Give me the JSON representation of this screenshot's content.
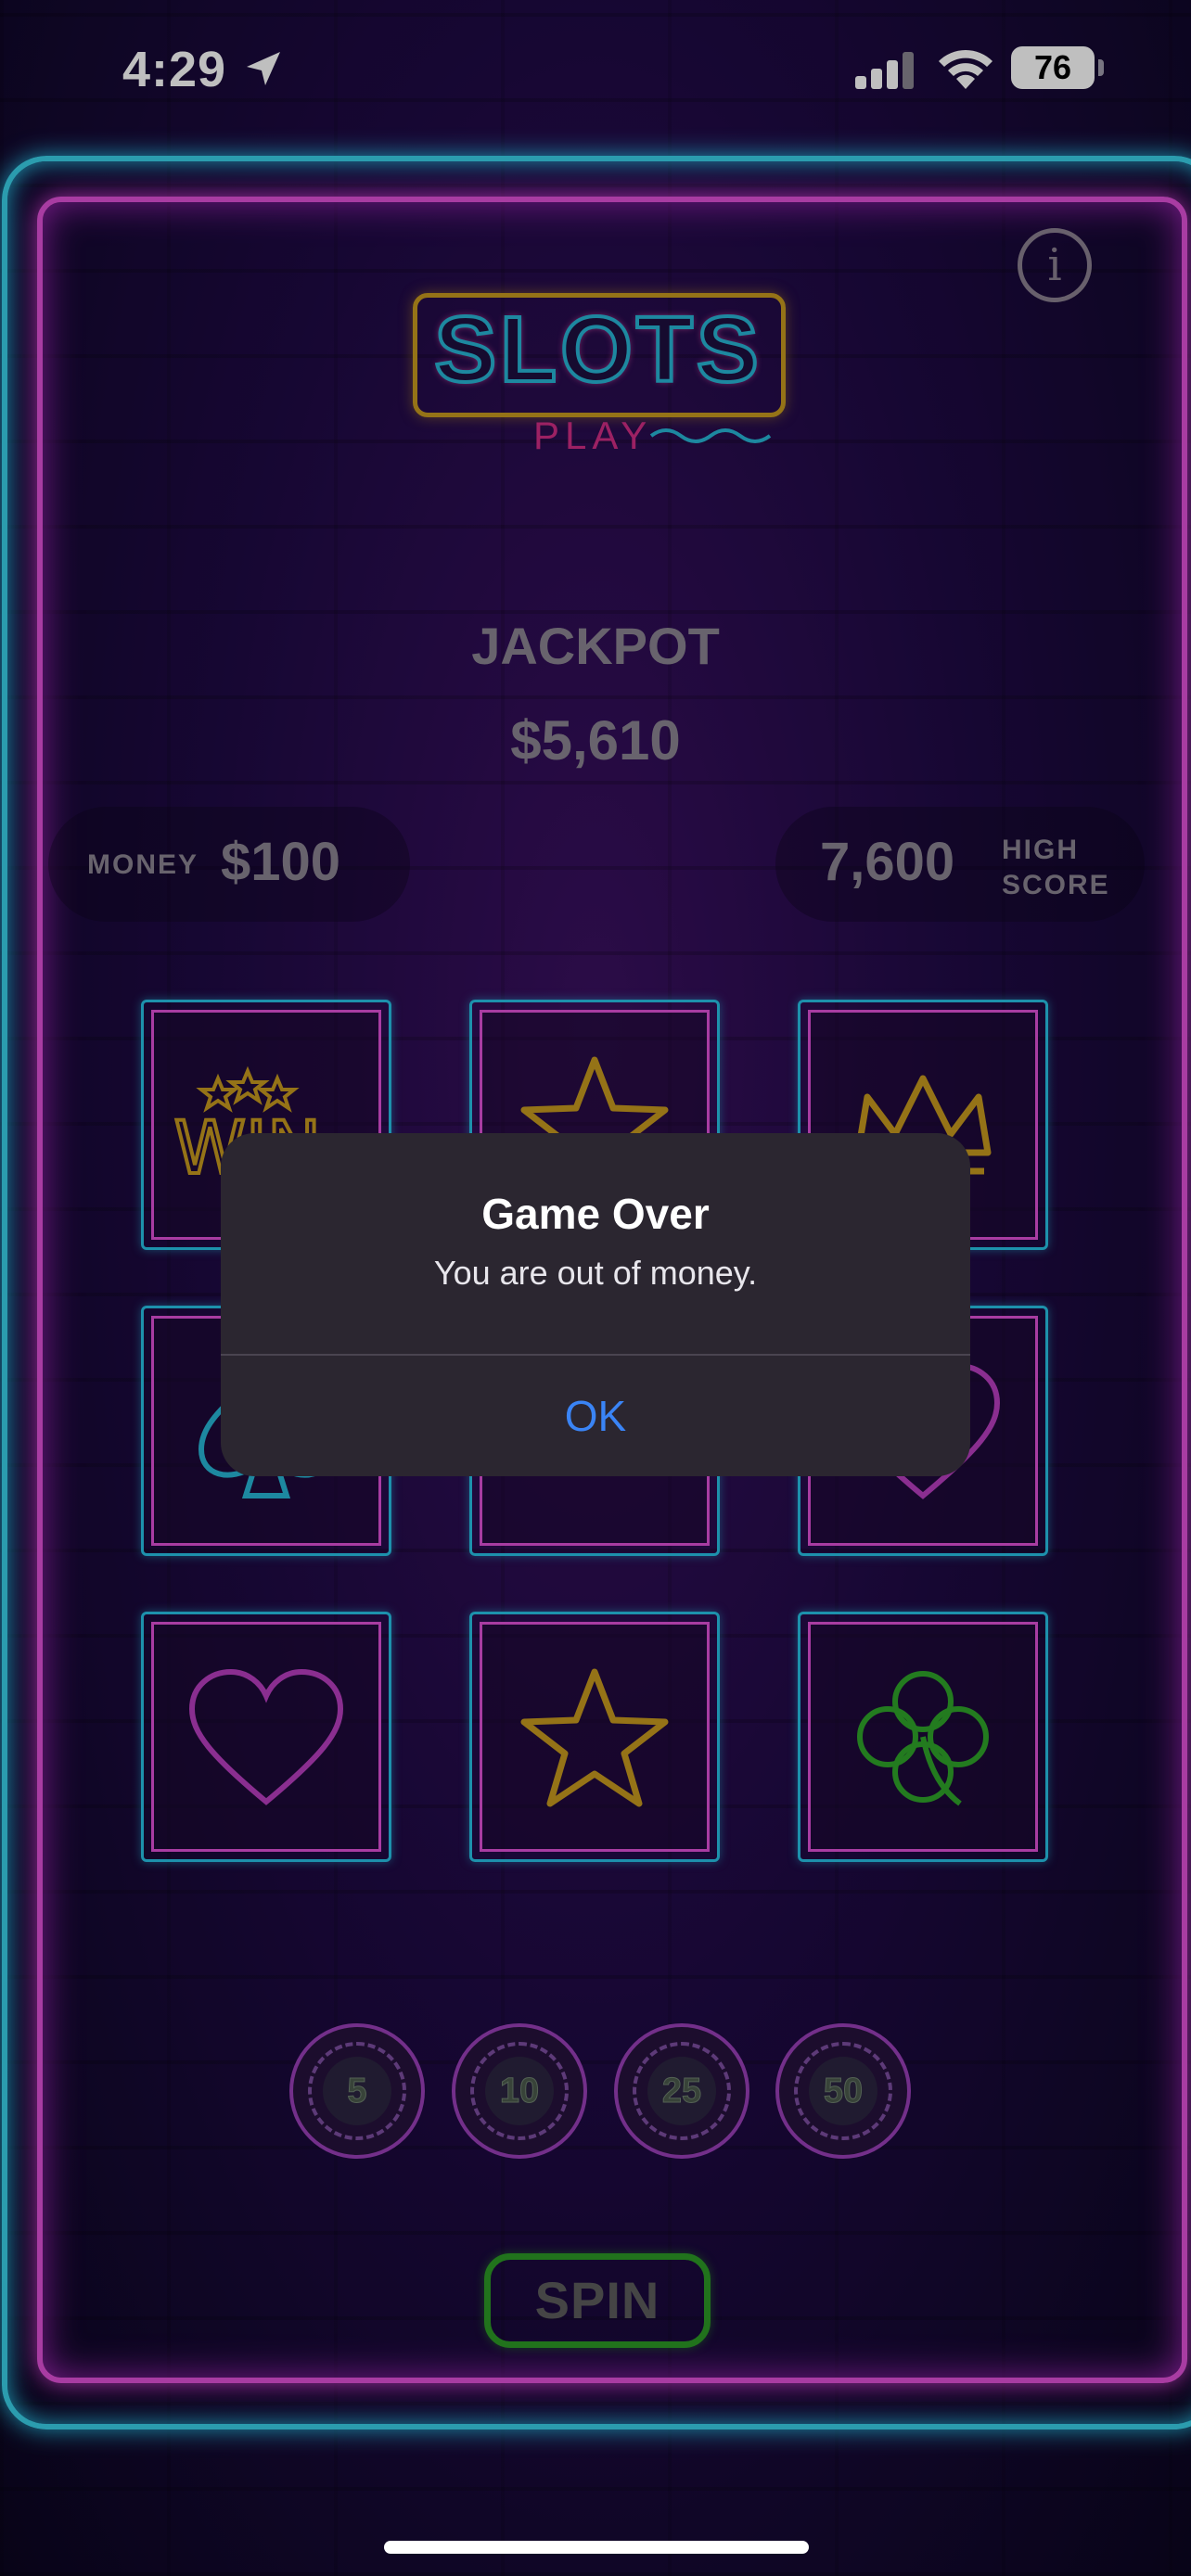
{
  "status_bar": {
    "time": "4:29",
    "battery": "76",
    "icons": [
      "location-arrow-icon",
      "cellular-signal-icon",
      "wifi-icon",
      "battery-icon"
    ]
  },
  "header": {
    "logo_title": "SLOTS",
    "logo_subtitle": "PLAY",
    "info_icon": "info-icon"
  },
  "jackpot": {
    "label": "JACKPOT",
    "value": "$5,610"
  },
  "money": {
    "label": "MONEY",
    "value": "$100"
  },
  "high_score": {
    "value": "7,600",
    "label_line1": "HIGH",
    "label_line2": "SCORE"
  },
  "reels": [
    [
      "win-stars-icon",
      "star-icon",
      "crown-icon"
    ],
    [
      "spade-icon",
      "hidden",
      "heart-icon"
    ],
    [
      "heart-icon",
      "star-icon",
      "clover-icon"
    ]
  ],
  "reel_win_text": "WIN",
  "bets": [
    "5",
    "10",
    "25",
    "50"
  ],
  "spin_label": "SPIN",
  "colors": {
    "neon_cyan": "#27c2e6",
    "neon_pink": "#e050d8",
    "gold": "#c79a1f",
    "green": "#2c9a26",
    "alert_button": "#3a84f5"
  },
  "alert": {
    "title": "Game Over",
    "message": "You are out of money.",
    "ok_label": "OK"
  }
}
